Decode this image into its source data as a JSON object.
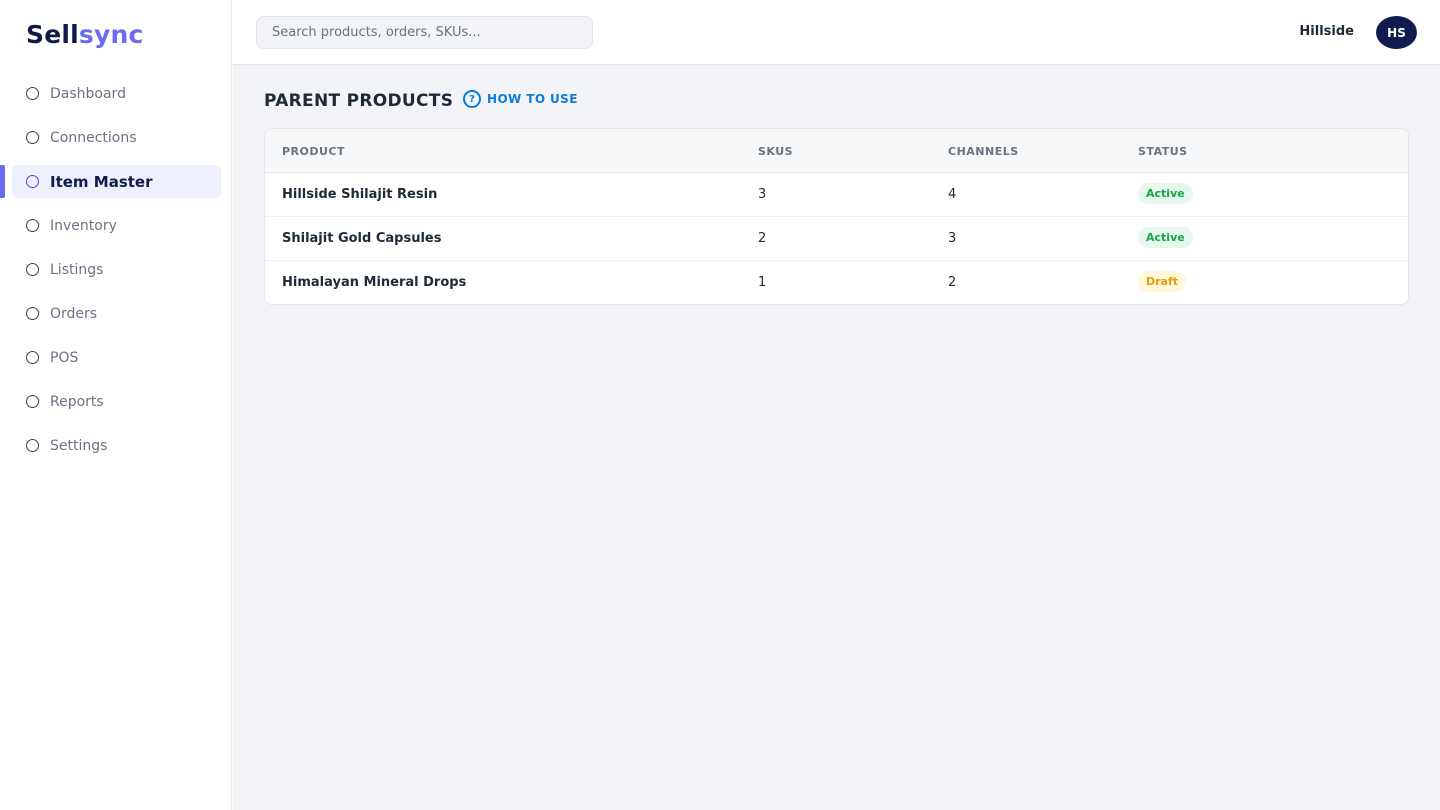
{
  "brand": {
    "part1": "Sell",
    "part2": "sync"
  },
  "sidebar": {
    "items": [
      {
        "label": "Dashboard",
        "active": false
      },
      {
        "label": "Connections",
        "active": false
      },
      {
        "label": "Item Master",
        "active": true
      },
      {
        "label": "Inventory",
        "active": false
      },
      {
        "label": "Listings",
        "active": false
      },
      {
        "label": "Orders",
        "active": false
      },
      {
        "label": "POS",
        "active": false
      },
      {
        "label": "Reports",
        "active": false
      },
      {
        "label": "Settings",
        "active": false
      }
    ]
  },
  "header": {
    "search_placeholder": "Search products, orders, SKUs...",
    "user_name": "Hillside",
    "avatar_initials": "HS"
  },
  "main": {
    "title": "PARENT PRODUCTS",
    "how_to_use": "HOW TO USE",
    "table": {
      "columns": [
        "PRODUCT",
        "SKUS",
        "CHANNELS",
        "STATUS"
      ],
      "rows": [
        {
          "product": "Hillside Shilajit Resin",
          "skus": "3",
          "channels": "4",
          "status": "Active"
        },
        {
          "product": "Shilajit Gold Capsules",
          "skus": "2",
          "channels": "3",
          "status": "Active"
        },
        {
          "product": "Himalayan Mineral Drops",
          "skus": "1",
          "channels": "2",
          "status": "Draft"
        }
      ]
    }
  },
  "colors": {
    "brand_dark": "#0f1a4a",
    "brand_accent": "#6b6bf0",
    "link_blue": "#0b7bdc",
    "status_active": "#16a34a",
    "status_draft": "#e0a000"
  },
  "icons": {
    "nav_item": "circle-outline-icon",
    "how_to_use": "question-circle-icon"
  }
}
